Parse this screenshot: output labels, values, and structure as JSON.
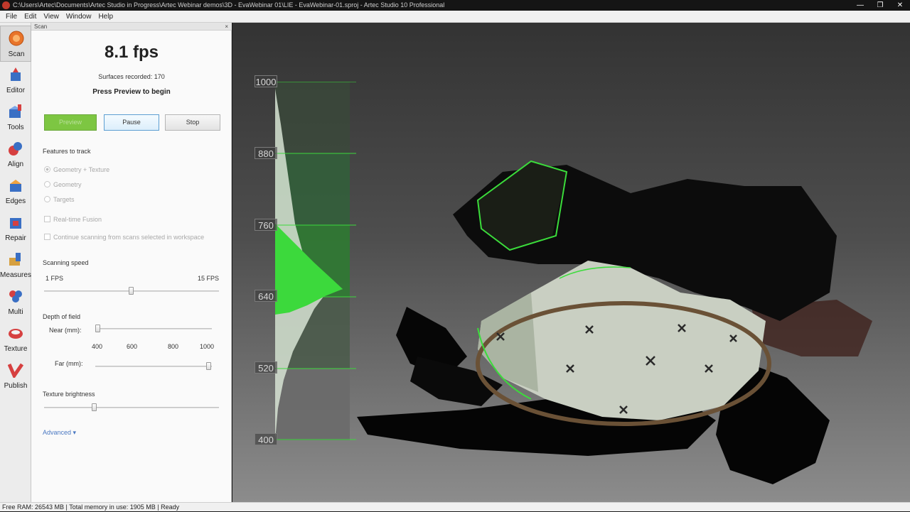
{
  "titlebar": {
    "title": "C:\\Users\\Artec\\Documents\\Artec Studio in Progress\\Artec Webinar demos\\3D - EvaWebinar 01\\LIE - EvaWebinar-01.sproj - Artec Studio 10 Professional",
    "minimize": "—",
    "restore": "❐",
    "close": "✕"
  },
  "menu": [
    "File",
    "Edit",
    "View",
    "Window",
    "Help"
  ],
  "toolbar": {
    "items": [
      {
        "label": "Scan",
        "icon": "scan-icon"
      },
      {
        "label": "Editor",
        "icon": "editor-icon"
      },
      {
        "label": "Tools",
        "icon": "tools-icon"
      },
      {
        "label": "Align",
        "icon": "align-icon"
      },
      {
        "label": "Edges",
        "icon": "edges-icon"
      },
      {
        "label": "Repair",
        "icon": "repair-icon"
      },
      {
        "label": "Measures",
        "icon": "measures-icon"
      },
      {
        "label": "Multi",
        "icon": "multi-icon"
      },
      {
        "label": "Texture",
        "icon": "texture-icon"
      },
      {
        "label": "Publish",
        "icon": "publish-icon"
      }
    ],
    "active": "Scan"
  },
  "panel": {
    "header": "Scan",
    "close": "×",
    "fps": "8.1 fps",
    "surfaces": "Surfaces recorded: 170",
    "hint": "Press Preview to begin",
    "buttons": {
      "preview": "Preview",
      "pause": "Pause",
      "stop": "Stop"
    },
    "features_title": "Features to track",
    "features": {
      "geometry_texture": "Geometry + Texture",
      "geometry": "Geometry",
      "targets": "Targets"
    },
    "realtime_fusion": "Real-time Fusion",
    "continue_scanning": "Continue scanning from scans selected in workspace",
    "speed": {
      "title": "Scanning speed",
      "min": "1 FPS",
      "max": "15 FPS",
      "value_fraction": 0.5
    },
    "depth": {
      "title": "Depth of field",
      "near": "Near (mm):",
      "far": "Far (mm):",
      "ticks": [
        "400",
        "600",
        "800",
        "1000"
      ],
      "near_fraction": 0.0,
      "far_fraction": 1.0
    },
    "texture_brightness": {
      "title": "Texture brightness",
      "value_fraction": 0.28
    },
    "advanced": "Advanced ▾"
  },
  "histogram": {
    "ticks": [
      "1000",
      "880",
      "760",
      "640",
      "520",
      "400"
    ],
    "colors": {
      "green_bright": "#3cd93c",
      "green_dark": "#2f5a2f",
      "gray": "#6b6b6b",
      "light": "#cfe6cf"
    }
  },
  "status": "Free RAM: 26543 MB  |  Total memory in use: 1905 MB  |  Ready"
}
